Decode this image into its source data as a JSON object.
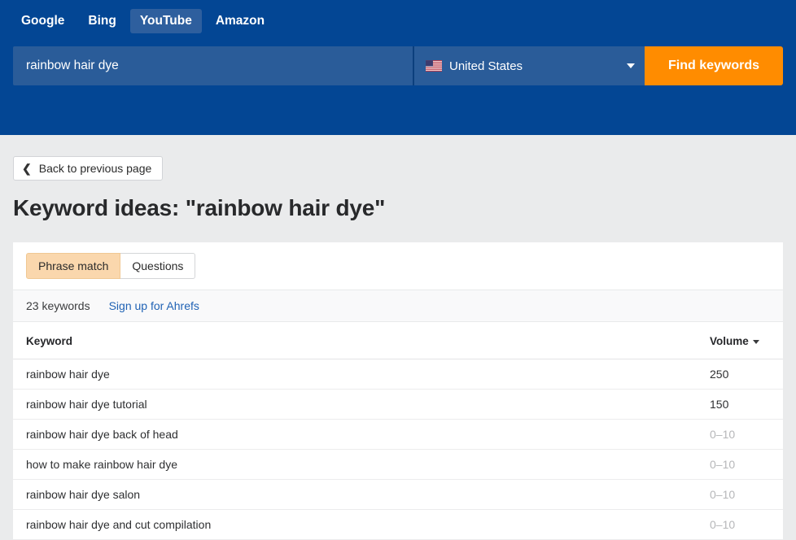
{
  "header": {
    "engines": [
      {
        "label": "Google",
        "active": false
      },
      {
        "label": "Bing",
        "active": false
      },
      {
        "label": "YouTube",
        "active": true
      },
      {
        "label": "Amazon",
        "active": false
      }
    ],
    "search": {
      "value": "rainbow hair dye",
      "placeholder": "Enter keyword"
    },
    "country": {
      "label": "United States",
      "flag_icon": "us-flag-icon",
      "caret_icon": "chevron-down-icon"
    },
    "find_button": "Find keywords",
    "colors": {
      "header_bg": "#034694",
      "field_bg": "#2a5c99",
      "cta_bg": "#ff8c00",
      "active_tab_bg": "#2e5f9e"
    }
  },
  "toolbar": {
    "back_label": "Back to previous page",
    "back_icon": "chevron-left-icon"
  },
  "page_title": "Keyword ideas: \"rainbow hair dye\"",
  "card": {
    "match_tabs": [
      {
        "label": "Phrase match",
        "active": true
      },
      {
        "label": "Questions",
        "active": false
      }
    ],
    "count_text": "23 keywords",
    "signup_link": "Sign up for Ahrefs",
    "table": {
      "columns": [
        "Keyword",
        "Volume"
      ],
      "sort_icon": "sort-descending-caret-icon",
      "rows": [
        {
          "keyword": "rainbow hair dye",
          "volume": "250",
          "dim": false
        },
        {
          "keyword": "rainbow hair dye tutorial",
          "volume": "150",
          "dim": false
        },
        {
          "keyword": "rainbow hair dye back of head",
          "volume": "0–10",
          "dim": true
        },
        {
          "keyword": "how to make rainbow hair dye",
          "volume": "0–10",
          "dim": true
        },
        {
          "keyword": "rainbow hair dye salon",
          "volume": "0–10",
          "dim": true
        },
        {
          "keyword": "rainbow hair dye and cut compilation",
          "volume": "0–10",
          "dim": true
        }
      ]
    },
    "colors": {
      "active_tab_bg": "#fad7ad",
      "link": "#2163b5",
      "dim_value": "#b6b7b9"
    }
  }
}
